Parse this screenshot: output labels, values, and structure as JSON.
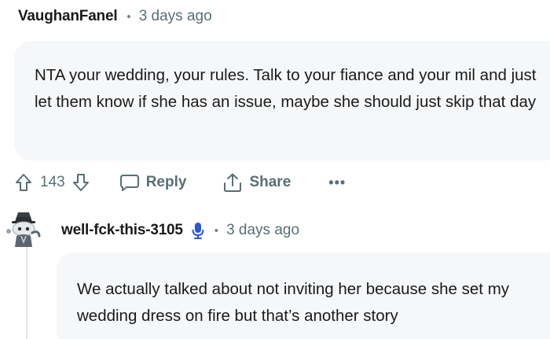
{
  "comment1": {
    "username": "VaughanFanel",
    "separator": "•",
    "timestamp": "3 days ago",
    "body": "NTA your wedding, your rules. Talk to your fiance and your mil and just let them know if she has an issue, maybe she should just skip that day",
    "actions": {
      "upvote_icon": "arrow-up-outline-icon",
      "vote_count": "143",
      "downvote_icon": "arrow-down-outline-icon",
      "reply_label": "Reply",
      "share_label": "Share",
      "more_label": "•••"
    }
  },
  "comment2": {
    "username": "well-fck-this-3105",
    "badge_icon": "microphone-icon",
    "separator": "•",
    "timestamp": "3 days ago",
    "body": "We actually talked about not inviting her because she set my wedding dress on fire but that’s another story"
  },
  "colors": {
    "bubble_bg": "#f6f7f8",
    "meta_text": "#576f76",
    "badge_blue": "#2b56d4"
  }
}
